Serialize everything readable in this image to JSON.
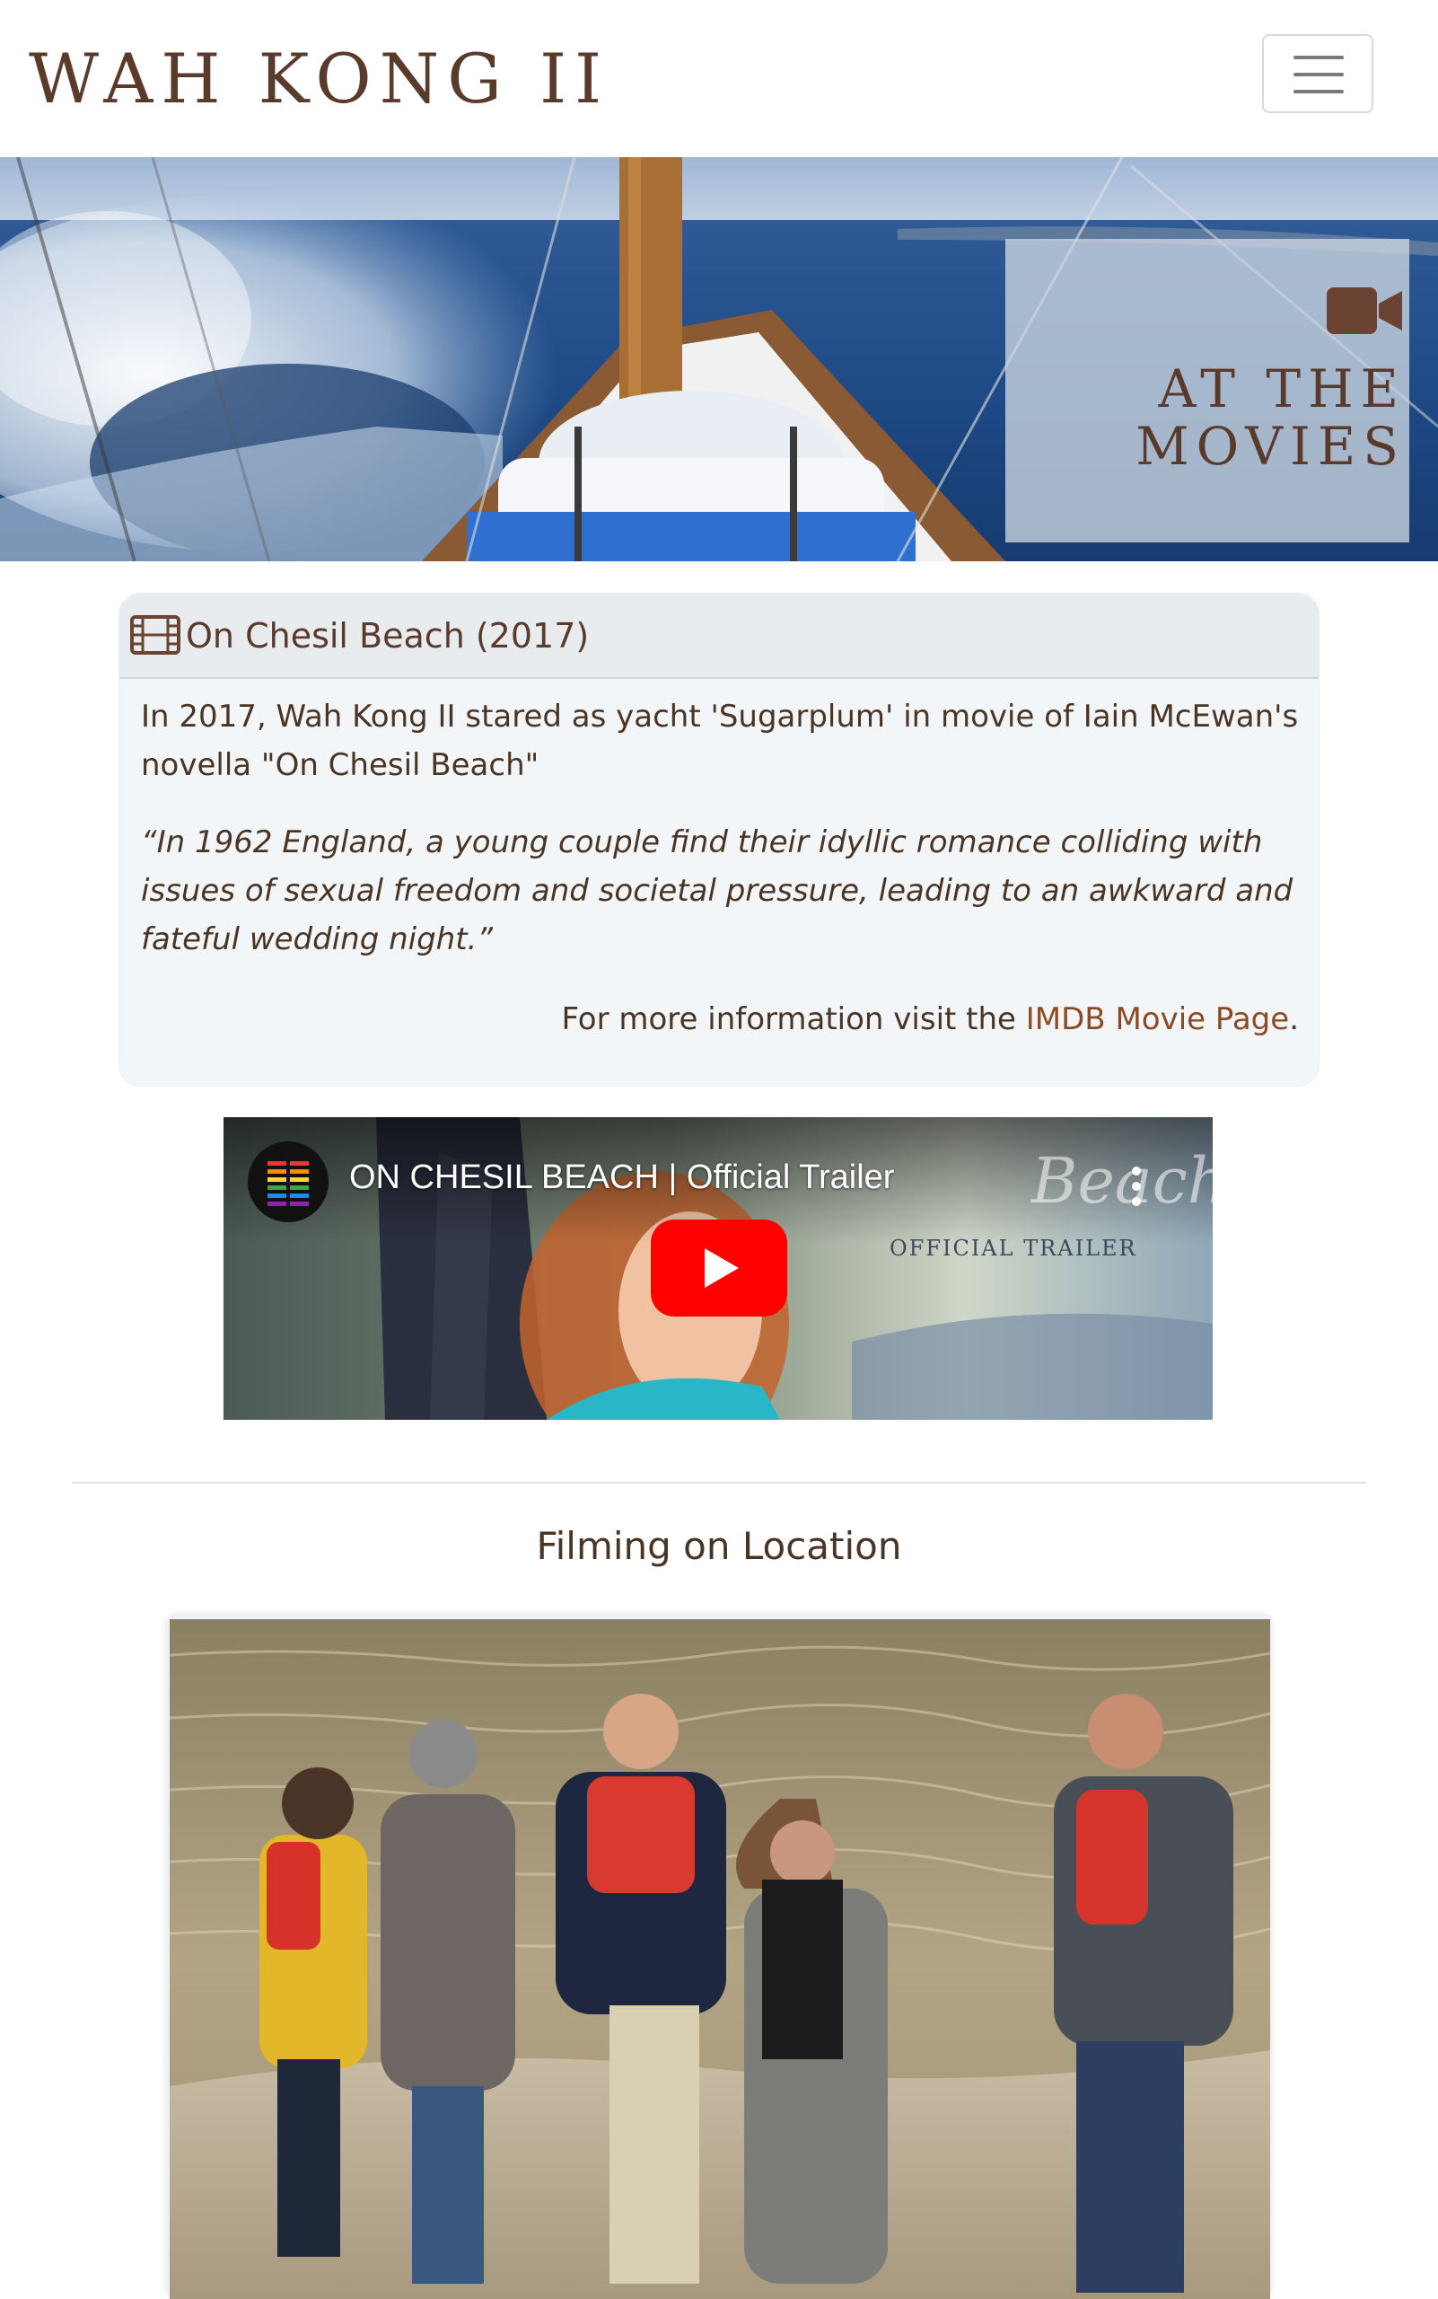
{
  "brand": {
    "name": "WAH KONG II"
  },
  "nav": {
    "menu_icon": "hamburger-menu-icon"
  },
  "hero": {
    "icon": "video-camera-icon",
    "title_line1": "AT THE",
    "title_line2": "MOVIES"
  },
  "card": {
    "icon": "film-strip-icon",
    "title": "On Chesil Beach (2017)",
    "intro": "In 2017, Wah Kong II stared as yacht 'Sugarplum' in movie of Iain McEwan's novella \"On Chesil Beach\"",
    "quote": "“In 1962 England, a young couple find their idyllic romance colliding with issues of sexual freedom and societal pressure, leading to an awkward and fateful wedding night.”",
    "more_prefix": "For more information visit the ",
    "more_link": "IMDB Movie Page",
    "more_suffix": "."
  },
  "video": {
    "title": "ON CHESIL BEACH | Official Trailer",
    "overlay_text": "OFFICIAL TRAILER",
    "overlay_script": "Beach",
    "play_icon": "youtube-play-icon",
    "channel_icon": "channel-logo-icon",
    "more_icon": "more-options-icon"
  },
  "section": {
    "title": "Filming on Location"
  },
  "colors": {
    "accent": "#8b4a22",
    "brown": "#5a3a2a",
    "card_bg": "#f3f6f8"
  }
}
